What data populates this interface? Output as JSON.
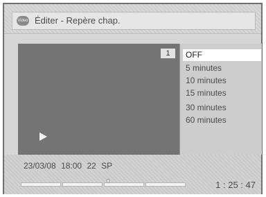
{
  "header": {
    "icon": "video-icon",
    "icon_label": "Video",
    "title": "Éditer - Repère chap."
  },
  "preview": {
    "chapter_number": "1",
    "play_icon": "play-icon"
  },
  "options": [
    "OFF",
    "5 minutes",
    "10 minutes",
    "15 minutes",
    "30 minutes",
    "60 minutes"
  ],
  "status": {
    "date": "23/03/08",
    "time": "18:00",
    "channel": "22",
    "mode": "SP",
    "elapsed": "1 : 25 : 47"
  }
}
